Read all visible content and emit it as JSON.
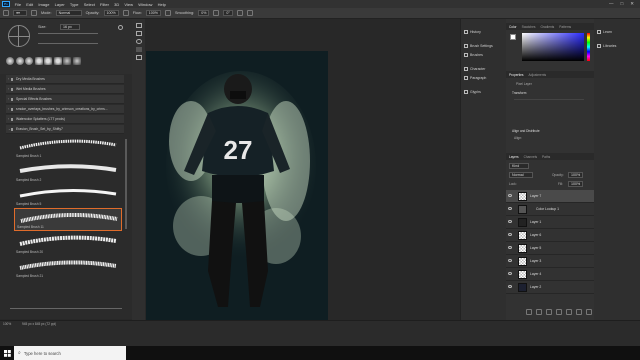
{
  "menubar": {
    "logo": "Ps",
    "items": [
      "File",
      "Edit",
      "Image",
      "Layer",
      "Type",
      "Select",
      "Filter",
      "3D",
      "View",
      "Window",
      "Help"
    ],
    "window_controls": [
      "—",
      "□",
      "✕"
    ]
  },
  "options_bar": {
    "mode_label": "Mode:",
    "mode_value": "Normal",
    "opacity_label": "Opacity:",
    "opacity_value": "100%",
    "flow_label": "Flow:",
    "flow_value": "100%",
    "smoothing_label": "Smoothing:",
    "smoothing_value": "0%",
    "angle_value": "0°"
  },
  "brush_panel": {
    "size_label": "Size:",
    "size_value": "16 px",
    "folders": [
      "Dry Media Brushes",
      "Wet Media Brushes",
      "Special Effects Brushes",
      "smoke_overlays_brushes_by_crimson_creations_by_crims...",
      "Watercolor Splatters (LTT prods)",
      "Erasion_Brush_Set_by_Shifty7"
    ],
    "brushes": [
      {
        "name": "Sampled Brush 1",
        "selected": false
      },
      {
        "name": "Sampled Brush 2",
        "selected": false
      },
      {
        "name": "Sampled Brush 5",
        "selected": false
      },
      {
        "name": "Sampled Brush 11",
        "selected": true
      },
      {
        "name": "Sampled Brush 20",
        "selected": false
      },
      {
        "name": "Sampled Brush 21",
        "selected": false
      }
    ]
  },
  "document": {
    "jersey_number": "27"
  },
  "side_dock": {
    "items": [
      "History",
      "Brush Settings",
      "Brushes",
      "Character",
      "Paragraph",
      "Glyphs"
    ]
  },
  "color_panel": {
    "tabs": [
      "Color",
      "Swatches",
      "Gradients",
      "Patterns"
    ],
    "hue_accent": "#2a2aff"
  },
  "properties_panel": {
    "tabs": [
      "Properties",
      "Adjustments"
    ],
    "subtitle": "Pixel Layer",
    "section1": "Transform",
    "section2": "Align and Distribute",
    "align_label": "Align:"
  },
  "layers_panel": {
    "tabs": [
      "Layers",
      "Channels",
      "Paths"
    ],
    "kind_label": "Kind",
    "blend_mode": "Normal",
    "opacity_label": "Opacity:",
    "opacity_value": "100%",
    "lock_label": "Lock:",
    "fill_label": "Fill:",
    "fill_value": "100%",
    "layers": [
      {
        "name": "Layer 7",
        "selected": true
      },
      {
        "name": "Color Lookup 1",
        "selected": false
      },
      {
        "name": "Layer 1",
        "selected": false
      },
      {
        "name": "Layer 6",
        "selected": false
      },
      {
        "name": "Layer 5",
        "selected": false
      },
      {
        "name": "Layer 3",
        "selected": false
      },
      {
        "name": "Layer 4",
        "selected": false
      },
      {
        "name": "Layer 2",
        "selected": false
      }
    ]
  },
  "lib_dock": {
    "items": [
      "Learn",
      "Libraries"
    ]
  },
  "statusbar": {
    "zoom": "100%",
    "doc_size": "945 px x 845 px (72 ppi)"
  },
  "taskbar": {
    "search_placeholder": "Type here to search"
  }
}
